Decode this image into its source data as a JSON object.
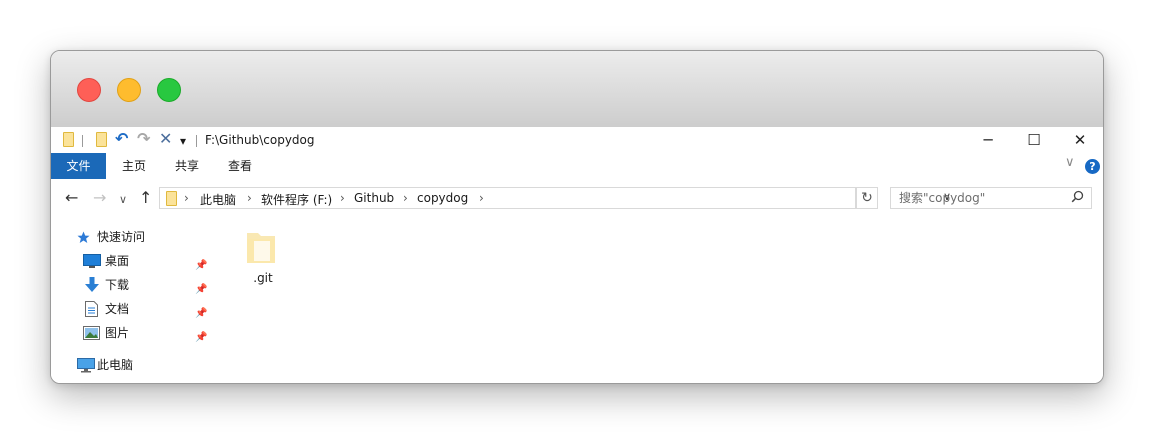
{
  "window": {
    "path": "F:\\Github\\copydog",
    "controls": {
      "minimize": "─",
      "maximize": "☐",
      "close": "✕"
    }
  },
  "quick_access_toolbar": {
    "undo": "↶",
    "redo": "↷",
    "delete": "✕",
    "customize": "▾"
  },
  "ribbon": {
    "tabs": [
      "文件",
      "主页",
      "共享",
      "查看"
    ],
    "expand_chevron": "∨",
    "help": "?",
    "colors": {
      "file_tab": "#1b69b8"
    }
  },
  "navigation": {
    "back": "←",
    "forward": "→",
    "recent": "∨",
    "up": "↑"
  },
  "address_bar": {
    "crumbs": [
      "此电脑",
      "软件程序 (F:)",
      "Github",
      "copydog"
    ],
    "separator": "›",
    "dropdown": "∨",
    "refresh": "↻"
  },
  "search": {
    "placeholder": "搜索\"copydog\""
  },
  "sidebar": {
    "quick_access": "快速访问",
    "items": [
      {
        "label": "桌面",
        "icon": "desktop-icon",
        "pinned": true
      },
      {
        "label": "下载",
        "icon": "download-icon",
        "pinned": true
      },
      {
        "label": "文档",
        "icon": "document-icon",
        "pinned": true
      },
      {
        "label": "图片",
        "icon": "picture-icon",
        "pinned": true
      }
    ],
    "this_pc": "此电脑",
    "pin_glyph": "📌"
  },
  "files": [
    {
      "name": ".git",
      "icon": "folder-icon"
    }
  ]
}
